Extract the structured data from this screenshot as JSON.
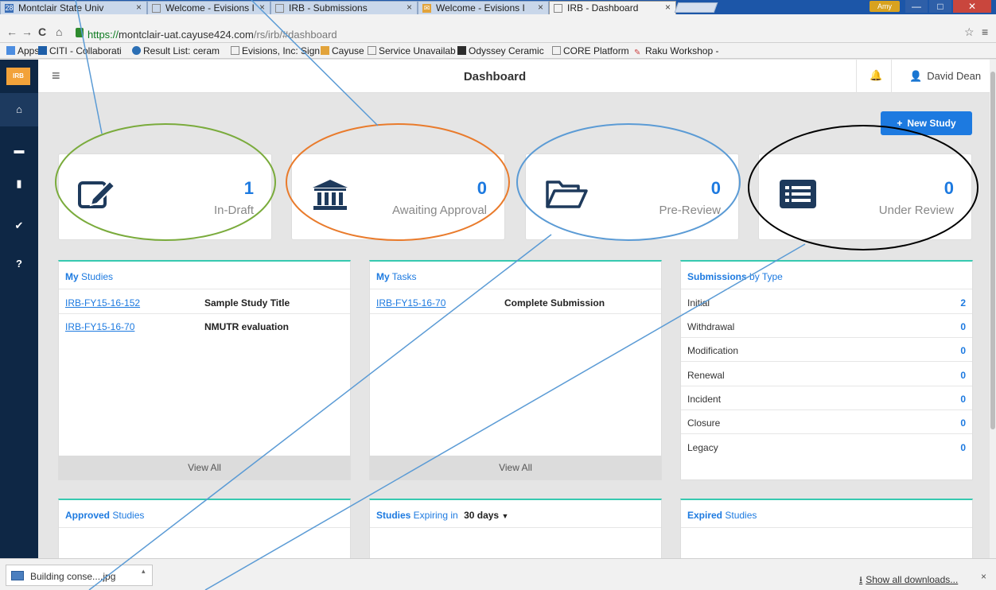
{
  "browser": {
    "tabs": [
      {
        "label": "Montclair State Univ",
        "favicon": "calendar-icon",
        "color": "#3b6fb7"
      },
      {
        "label": "Welcome - Evisions I",
        "favicon": "page-icon",
        "color": "#888888"
      },
      {
        "label": "IRB - Submissions",
        "favicon": "page-icon",
        "color": "#888888"
      },
      {
        "label": "Welcome - Evisions I",
        "favicon": "mail-icon",
        "color": "#e2a33a"
      },
      {
        "label": "IRB - Dashboard",
        "favicon": "page-icon",
        "color": "#888888"
      }
    ],
    "user_badge": "Amy",
    "url_scheme": "https://",
    "url_host": "montclair-uat.cayuse424.com",
    "url_path": "/rs/irb/#dashboard",
    "bookmarks": [
      {
        "label": "Apps",
        "icon": "apps-grid-icon"
      },
      {
        "label": "CITI - Collaborati",
        "icon": "citi-icon"
      },
      {
        "label": "Result List: ceram",
        "icon": "ebsco-icon"
      },
      {
        "label": "Evisions, Inc: Sign",
        "icon": "page-icon"
      },
      {
        "label": "Cayuse",
        "icon": "mail-icon"
      },
      {
        "label": "Service Unavailab",
        "icon": "page-icon"
      },
      {
        "label": "Odyssey Ceramic",
        "icon": "odyssey-icon"
      },
      {
        "label": "CORE Platform",
        "icon": "page-icon"
      },
      {
        "label": "Raku Workshop -",
        "icon": "raku-icon"
      }
    ]
  },
  "app": {
    "logo_text": "IRB",
    "title": "Dashboard",
    "user_name": "David Dean",
    "new_study_label": "New Study",
    "sidebar": [
      "home-icon",
      "folder-icon",
      "document-icon",
      "check-icon",
      "help-icon"
    ],
    "sidebar_help": "?",
    "stats": [
      {
        "value": "1",
        "label": "In-Draft",
        "icon": "edit-icon"
      },
      {
        "value": "0",
        "label": "Awaiting Approval",
        "icon": "institution-icon"
      },
      {
        "value": "0",
        "label": "Pre-Review",
        "icon": "open-folder-icon"
      },
      {
        "value": "0",
        "label": "Under Review",
        "icon": "list-icon"
      }
    ],
    "my_studies": {
      "title_bold": "My",
      "title_rest": " Studies",
      "rows": [
        {
          "id": "IRB-FY15-16-152",
          "title": "Sample Study Title"
        },
        {
          "id": "IRB-FY15-16-70",
          "title": "NMUTR evaluation"
        }
      ],
      "view_all": "View All"
    },
    "my_tasks": {
      "title_bold": "My",
      "title_rest": " Tasks",
      "rows": [
        {
          "id": "IRB-FY15-16-70",
          "title": "Complete Submission"
        }
      ],
      "view_all": "View All"
    },
    "submissions_by_type": {
      "title_bold": "Submissions",
      "title_rest": " by Type",
      "rows": [
        {
          "label": "Initial",
          "value": "2"
        },
        {
          "label": "Withdrawal",
          "value": "0"
        },
        {
          "label": "Modification",
          "value": "0"
        },
        {
          "label": "Renewal",
          "value": "0"
        },
        {
          "label": "Incident",
          "value": "0"
        },
        {
          "label": "Closure",
          "value": "0"
        },
        {
          "label": "Legacy",
          "value": "0"
        }
      ]
    },
    "approved_studies": {
      "title_bold": "Approved",
      "title_rest": " Studies"
    },
    "studies_expiring": {
      "title_bold": "Studies",
      "title_rest": " Expiring in",
      "period": "30 days"
    },
    "expired_studies": {
      "title_bold": "Expired",
      "title_rest": " Studies"
    }
  },
  "downloads": {
    "file_name": "Building conse....jpg",
    "show_all": "Show all downloads...",
    "close": "×"
  },
  "colors": {
    "accent": "#1d7ae0",
    "sidebar": "#0e2745",
    "panel_top": "#36c9b0",
    "annotation_green": "#7aab3c",
    "annotation_orange": "#e97b2c",
    "annotation_blue": "#5b9bd5",
    "annotation_black": "#000000"
  }
}
